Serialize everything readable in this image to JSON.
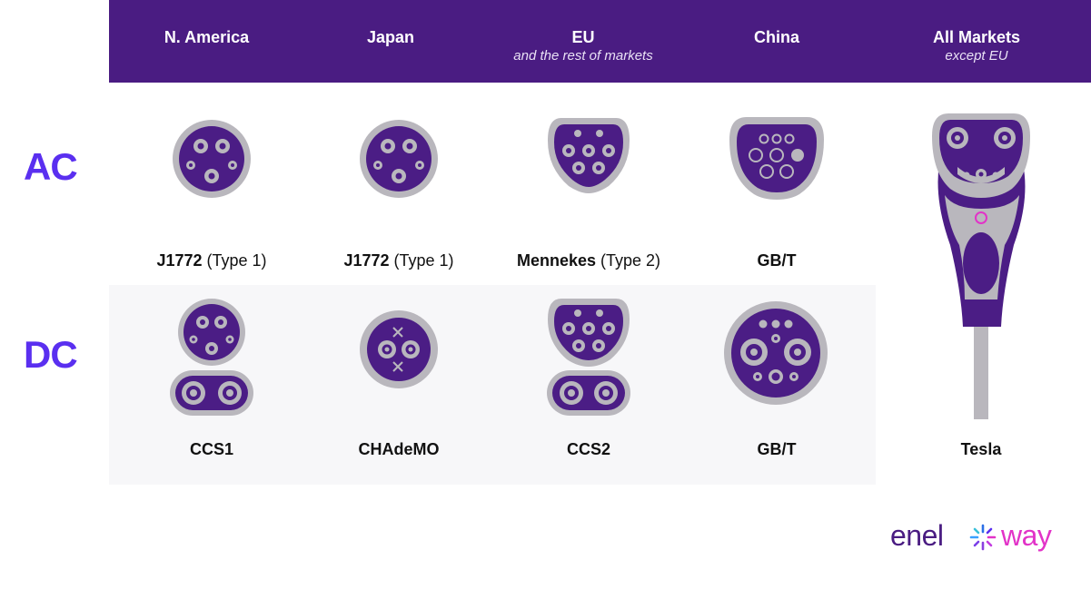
{
  "header": {
    "columns": [
      {
        "title": "N. America",
        "subtitle": ""
      },
      {
        "title": "Japan",
        "subtitle": ""
      },
      {
        "title": "EU",
        "subtitle": "and the rest of markets"
      },
      {
        "title": "China",
        "subtitle": ""
      },
      {
        "title": "All Markets",
        "subtitle": "except EU"
      }
    ]
  },
  "rows": {
    "ac": "AC",
    "dc": "DC"
  },
  "ac_labels": [
    {
      "name": "J1772",
      "detail": "(Type 1)"
    },
    {
      "name": "J1772",
      "detail": "(Type 1)"
    },
    {
      "name": "Mennekes",
      "detail": "(Type 2)"
    },
    {
      "name": "GB/T",
      "detail": ""
    }
  ],
  "dc_labels": [
    "CCS1",
    "CHAdeMO",
    "CCS2",
    "GB/T"
  ],
  "tesla_label": "Tesla",
  "brand": {
    "part1": "enel",
    "part2": "way",
    "color_dark": "#4a1c82",
    "color_accent": "#e233c8",
    "icon": "starburst-icon"
  },
  "colors": {
    "header_bg": "#4a1c82",
    "plug_fill": "#4b1d85",
    "plug_rim": "#b9b7bd",
    "row_label": "#5a2ff0",
    "dc_band": "#f7f7f9"
  }
}
